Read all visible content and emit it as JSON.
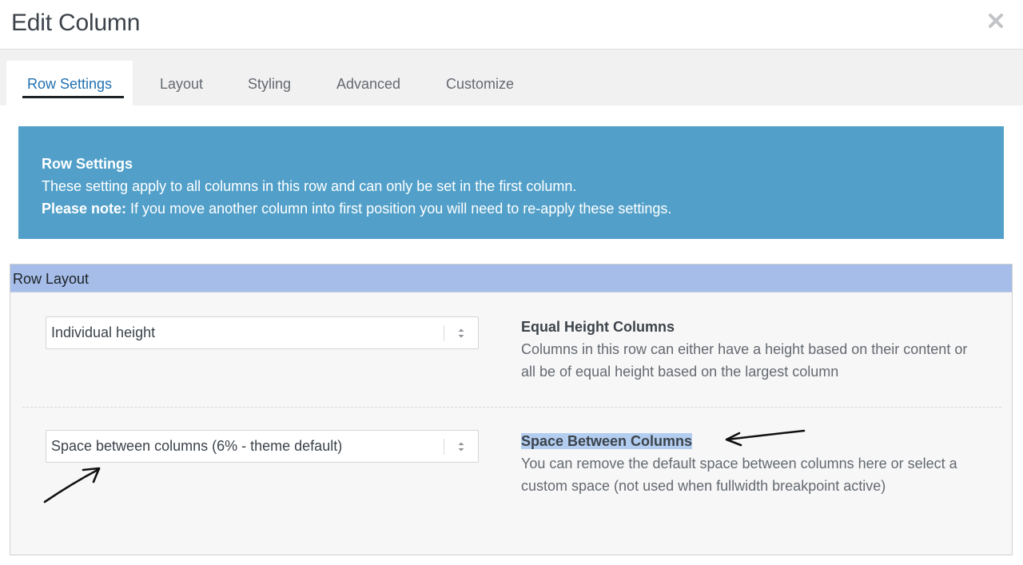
{
  "dialog": {
    "title": "Edit Column",
    "close_icon": "close-x-icon"
  },
  "tabs": [
    {
      "label": "Row Settings",
      "active": true
    },
    {
      "label": "Layout",
      "active": false
    },
    {
      "label": "Styling",
      "active": false
    },
    {
      "label": "Advanced",
      "active": false
    },
    {
      "label": "Customize",
      "active": false
    }
  ],
  "notice": {
    "heading": "Row Settings",
    "line1": "These setting apply to all columns in this row and can only be set in the first column.",
    "note_label": "Please note:",
    "note_text": " If you move another column into first position you will need to re-apply these settings."
  },
  "row_layout": {
    "heading": "Row Layout",
    "fields": [
      {
        "select_value": "Individual height",
        "title": "Equal Height Columns",
        "description": "Columns in this row can either have a height based on their content or all be of equal height based on the largest column"
      },
      {
        "select_value": "Space between columns (6% - theme default)",
        "title": "Space Between Columns",
        "description": "You can remove the default space between columns here or select a custom space (not used when fullwidth breakpoint active)"
      }
    ]
  },
  "colors": {
    "notice_bg": "#52a0c9",
    "panel_head_bg": "#a5bde8",
    "active_tab_text": "#2271b1",
    "highlight": "#b3cdf0"
  }
}
